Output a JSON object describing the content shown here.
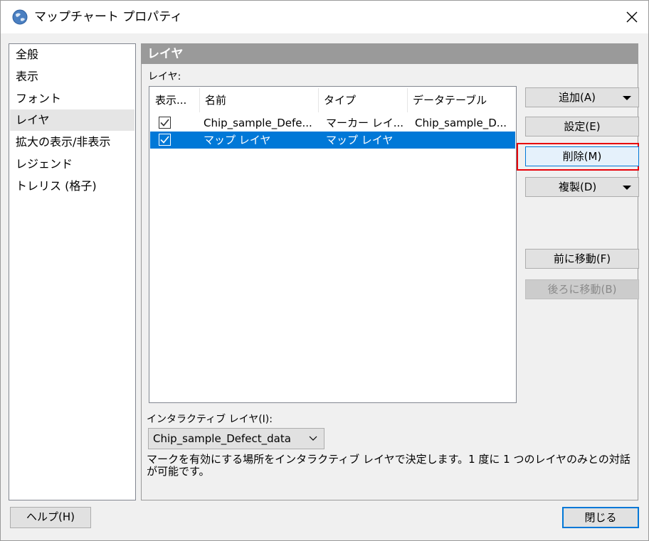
{
  "window": {
    "title": "マップチャート プロパティ",
    "app_icon": "globe-icon",
    "close_icon": "close-icon"
  },
  "nav": {
    "items": [
      {
        "label": "全般",
        "selected": false
      },
      {
        "label": "表示",
        "selected": false
      },
      {
        "label": "フォント",
        "selected": false
      },
      {
        "label": "レイヤ",
        "selected": true
      },
      {
        "label": "拡大の表示/非表示",
        "selected": false
      },
      {
        "label": "レジェンド",
        "selected": false
      },
      {
        "label": "トレリス (格子)",
        "selected": false
      }
    ]
  },
  "panel": {
    "header": "レイヤ",
    "layers_caption": "レイヤ:",
    "columns": [
      "表示...",
      "名前",
      "タイプ",
      "データテーブル"
    ],
    "rows": [
      {
        "visible": true,
        "name": "Chip_sample_Defe...",
        "type": "マーカー レイ...",
        "table": "Chip_sample_D...",
        "selected": false
      },
      {
        "visible": true,
        "name": "マップ レイヤ",
        "type": "マップ レイヤ",
        "table": "",
        "selected": true
      }
    ],
    "buttons": {
      "add": "追加(A)",
      "settings": "設定(E)",
      "delete": "削除(M)",
      "duplicate": "複製(D)",
      "move_up": "前に移動(F)",
      "move_down": "後ろに移動(B)"
    },
    "interactive_label": "インタラクティブ レイヤ(I):",
    "interactive_value": "Chip_sample_Defect_data",
    "description": "マークを有効にする場所をインタラクティブ レイヤで決定します。1 度に 1 つのレイヤのみとの対話が可能です。"
  },
  "footer": {
    "help": "ヘルプ(H)",
    "close": "閉じる"
  },
  "colors": {
    "selection": "#0078d7",
    "highlight_outline": "#e8000a",
    "panel_header": "#9a9a9a"
  }
}
